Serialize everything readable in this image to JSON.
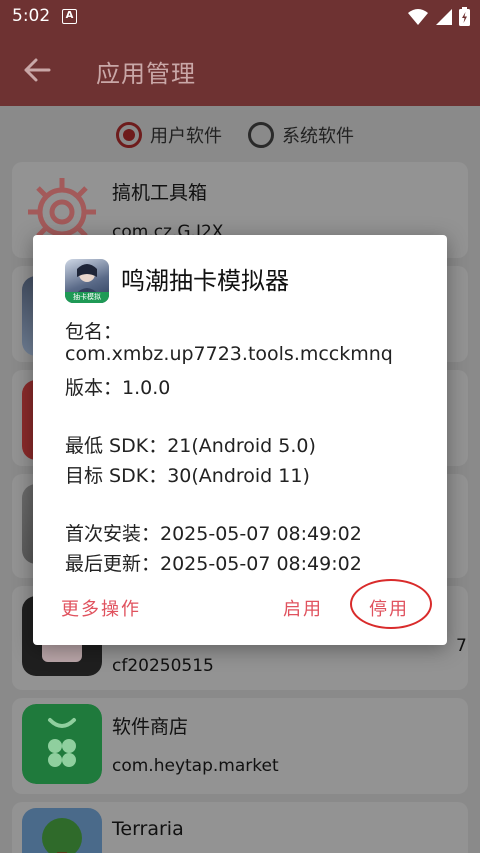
{
  "status": {
    "time": "5:02",
    "notif_letter": "A"
  },
  "appbar": {
    "title": "应用管理"
  },
  "filter": {
    "user_apps": "用户软件",
    "system_apps": "系统软件",
    "selected": "user_apps"
  },
  "list": {
    "item0": {
      "name": "搞机工具箱",
      "pkg": "com.cz.G.J2X"
    },
    "item4": {
      "pkg_line2": "cf20250515",
      "pkg_tail": "7"
    },
    "item5": {
      "name": "软件商店",
      "pkg": "com.heytap.market"
    },
    "item6": {
      "name": "Terraria"
    }
  },
  "dialog": {
    "title": "鸣潮抽卡模拟器",
    "icon_caption": "抽卡模拟",
    "package_label": "包名：",
    "package": "com.xmbz.up7723.tools.mcckmnq",
    "version": "版本：1.0.0",
    "min_sdk": "最低 SDK：21(Android 5.0)",
    "target_sdk": "目标 SDK：30(Android 11)",
    "first_install": "首次安装：2025-05-07 08:49:02",
    "last_update": "最后更新：2025-05-07 08:49:02",
    "more_actions": "更多操作",
    "enable": "启用",
    "disable": "停用"
  },
  "colors": {
    "accent": "#6e3232",
    "button_text": "#e0525e",
    "highlight_ring": "#d92b2b"
  }
}
